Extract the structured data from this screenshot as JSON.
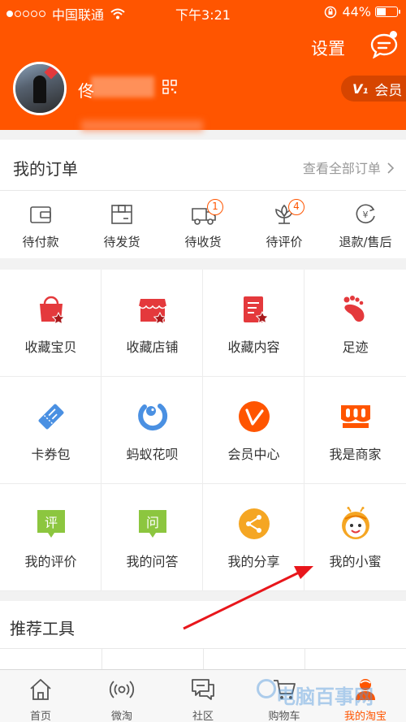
{
  "status_bar": {
    "carrier": "中国联通",
    "time": "下午3:21",
    "battery": "44%",
    "battery_level": 0.44
  },
  "header": {
    "settings_label": "设置",
    "username_visible": "佟",
    "vip_label": "会员",
    "vip_glyph": "V₁"
  },
  "orders": {
    "title": "我的订单",
    "view_all": "查看全部订单",
    "items": [
      {
        "label": "待付款",
        "icon": "wallet-icon"
      },
      {
        "label": "待发货",
        "icon": "package-icon"
      },
      {
        "label": "待收货",
        "icon": "truck-icon",
        "badge": "1"
      },
      {
        "label": "待评价",
        "icon": "flower-review-icon",
        "badge": "4"
      },
      {
        "label": "退款/售后",
        "icon": "refund-icon"
      }
    ]
  },
  "grid": {
    "items": [
      {
        "label": "收藏宝贝",
        "icon": "fav-item-icon"
      },
      {
        "label": "收藏店铺",
        "icon": "fav-shop-icon"
      },
      {
        "label": "收藏内容",
        "icon": "fav-content-icon"
      },
      {
        "label": "足迹",
        "icon": "footprint-icon"
      },
      {
        "label": "卡券包",
        "icon": "coupon-icon"
      },
      {
        "label": "蚂蚁花呗",
        "icon": "huabei-icon"
      },
      {
        "label": "会员中心",
        "icon": "vip-center-icon"
      },
      {
        "label": "我是商家",
        "icon": "merchant-icon"
      },
      {
        "label": "我的评价",
        "icon": "review-icon",
        "glyph": "评"
      },
      {
        "label": "我的问答",
        "icon": "qa-icon",
        "glyph": "问"
      },
      {
        "label": "我的分享",
        "icon": "share-icon"
      },
      {
        "label": "我的小蜜",
        "icon": "xiaomi-bee-icon"
      }
    ]
  },
  "recommended": {
    "title": "推荐工具"
  },
  "tabbar": {
    "items": [
      {
        "label": "首页",
        "icon": "home-icon"
      },
      {
        "label": "微淘",
        "icon": "broadcast-icon"
      },
      {
        "label": "社区",
        "icon": "community-icon"
      },
      {
        "label": "购物车",
        "icon": "cart-icon"
      },
      {
        "label": "我的淘宝",
        "icon": "my-taobao-icon",
        "active": true
      }
    ]
  },
  "watermark": "电脑百事网",
  "colors": {
    "brand_orange": "#ff5500",
    "red_icon": "#e4393c",
    "blue_icon": "#4a90e2",
    "green_icon": "#8cc63f",
    "amber_icon": "#f5a623"
  }
}
